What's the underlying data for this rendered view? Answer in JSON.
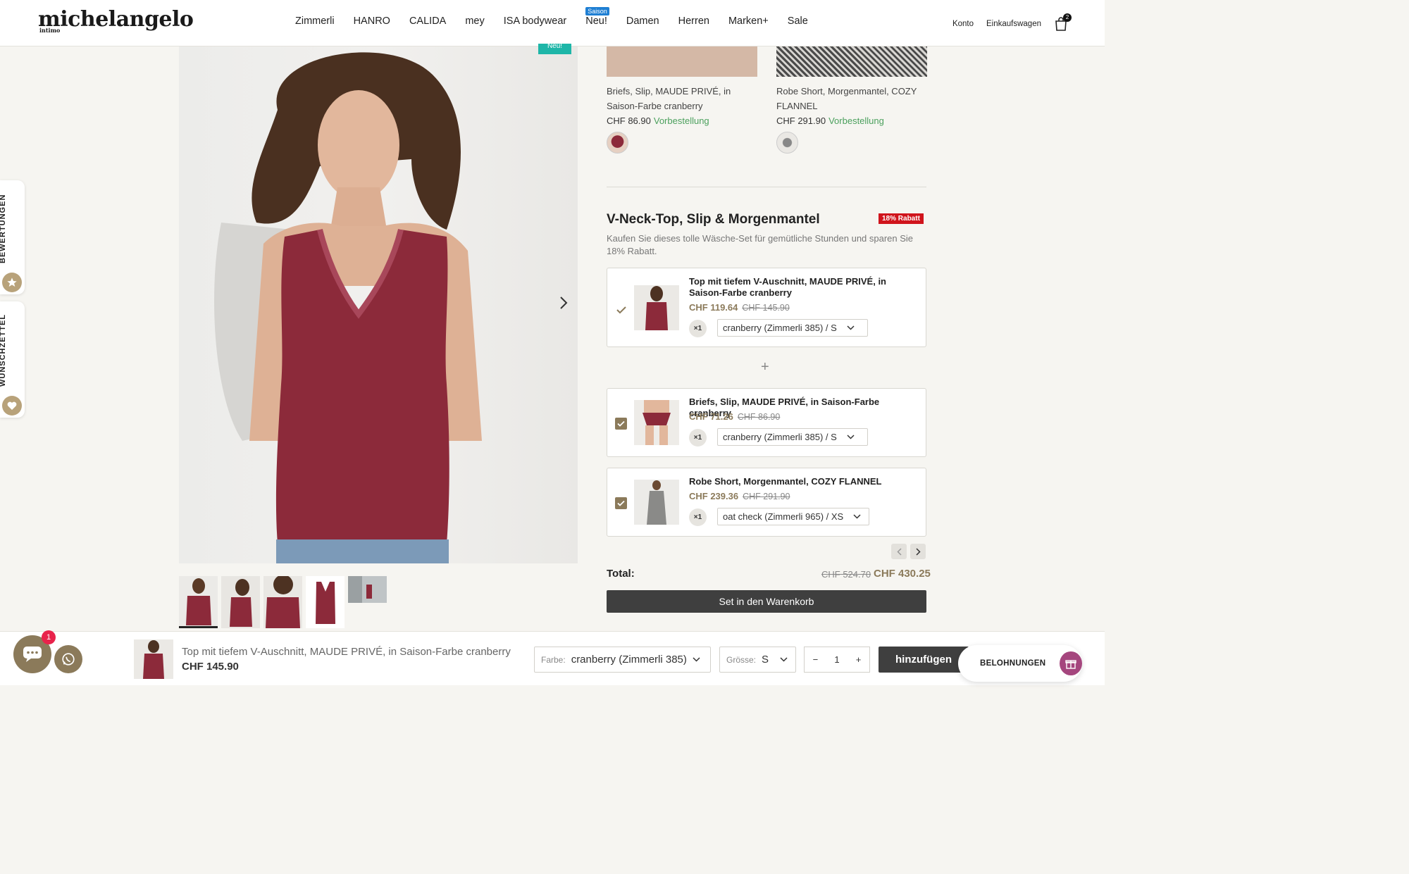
{
  "header": {
    "logo": "michelangelo",
    "logo_sub": "intimo",
    "nav": [
      {
        "label": "Zimmerli",
        "badge": ""
      },
      {
        "label": "HANRO",
        "badge": ""
      },
      {
        "label": "CALIDA",
        "badge": ""
      },
      {
        "label": "mey",
        "badge": ""
      },
      {
        "label": "ISA bodywear",
        "badge": ""
      },
      {
        "label": "Neu!",
        "badge": "Saison"
      },
      {
        "label": "Damen",
        "badge": ""
      },
      {
        "label": "Herren",
        "badge": ""
      },
      {
        "label": "Marken+",
        "badge": ""
      },
      {
        "label": "Sale",
        "badge": ""
      }
    ],
    "account": "Konto",
    "cart": "Einkaufswagen",
    "cart_count": "2"
  },
  "side_tabs": {
    "reviews": "BEWERTUNGEN",
    "wishlist": "WUNSCHZETTEL"
  },
  "gallery": {
    "badge": "Neu!",
    "thumb_count": 5
  },
  "top_products": [
    {
      "name": "Briefs, Slip, MAUDE PRIVÉ, in Saison-Farbe cranberry",
      "price": "CHF 86.90",
      "status": "Vorbestellung"
    },
    {
      "name": "Robe Short, Morgenmantel, COZY FLANNEL",
      "price": "CHF 291.90",
      "status": "Vorbestellung"
    }
  ],
  "bundle": {
    "title": "V-Neck-Top, Slip & Morgenmantel",
    "badge": "18% Rabatt",
    "description": "Kaufen Sie dieses tolle Wäsche-Set für gemütliche Stunden und sparen Sie 18% Rabatt.",
    "items": [
      {
        "name": "Top mit tiefem V-Auschnitt, MAUDE PRIVÉ, in Saison-Farbe cranberry",
        "price": "CHF 119.64",
        "old_price": "CHF 145.90",
        "qty": "×1",
        "variant": "cranberry (Zimmerli 385) / S"
      },
      {
        "name": "Briefs, Slip, MAUDE PRIVÉ, in Saison-Farbe cranberry",
        "price": "CHF 71.26",
        "old_price": "CHF 86.90",
        "qty": "×1",
        "variant": "cranberry (Zimmerli 385) / S"
      },
      {
        "name": "Robe Short, Morgenmantel, COZY FLANNEL",
        "price": "CHF 239.36",
        "old_price": "CHF 291.90",
        "qty": "×1",
        "variant": "oat check (Zimmerli 965) / XS"
      }
    ],
    "plus": "+",
    "total_label": "Total:",
    "total_old": "CHF 524.70",
    "total_new": "CHF 430.25",
    "add_button": "Set in den Warenkorb"
  },
  "sticky": {
    "chat_count": "1",
    "product_name": "Top mit tiefem V-Auschnitt, MAUDE PRIVÉ, in Saison-Farbe cranberry",
    "price": "CHF 145.90",
    "color_label": "Farbe:",
    "color_value": "cranberry (Zimmerli 385)",
    "size_label": "Grösse:",
    "size_value": "S",
    "qty_minus": "−",
    "qty": "1",
    "qty_plus": "+",
    "add_button": "hinzufügen",
    "rewards": "BELOHNUNGEN"
  },
  "colors": {
    "accent": "#8b7a5a",
    "sale_badge": "#d0141c",
    "preorder": "#4ba05d",
    "new_badge": "#1eb6a8",
    "button": "#3f3f3f"
  }
}
